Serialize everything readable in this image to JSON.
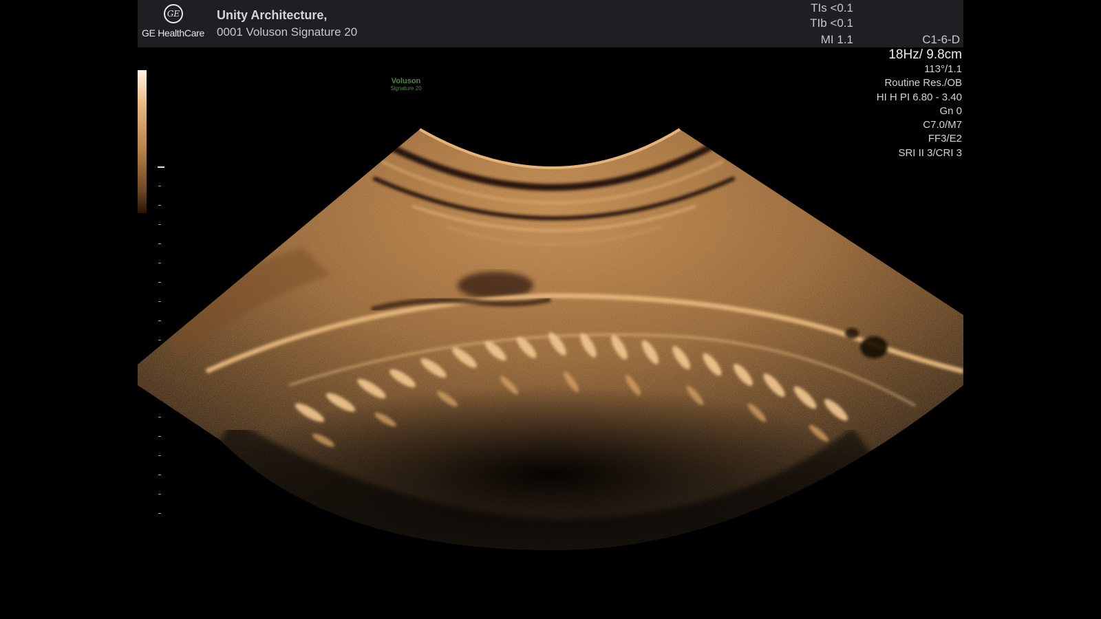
{
  "header": {
    "brand": "GE HealthCare",
    "site_name": "Unity Architecture,",
    "system_name": "0001 Voluson Signature 20",
    "indices": [
      "TIs <0.1",
      "TIb <0.1",
      "MI  1.1"
    ],
    "probe": "C1-6-D"
  },
  "scan_params": {
    "frame_depth": "18Hz/ 9.8cm",
    "rows": [
      "113°/1.1",
      "Routine Res./OB",
      "HI H PI 6.80 - 3.40",
      "Gn   0",
      "C7.0/M7",
      "FF3/E2",
      "SRI II 3/CRI 3"
    ]
  },
  "watermark": {
    "line1": "Voluson",
    "line2": "Signature 20"
  },
  "colors": {
    "header_bg": "#1e1f22",
    "tissue": "#c2894a",
    "watermark": "#4f8a3f"
  },
  "icons": [
    "ge-monogram-icon"
  ]
}
